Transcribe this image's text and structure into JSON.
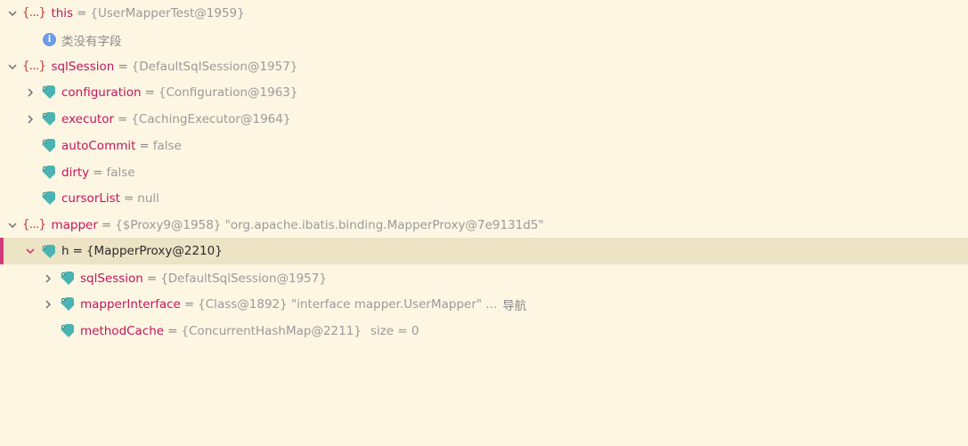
{
  "rows": [
    {
      "name": "this",
      "value": "{UserMapperTest@1959}"
    },
    {
      "message": "类没有字段"
    },
    {
      "name": "sqlSession",
      "value": "{DefaultSqlSession@1957}"
    },
    {
      "name": "configuration",
      "value": "{Configuration@1963}"
    },
    {
      "name": "executor",
      "value": "{CachingExecutor@1964}"
    },
    {
      "name": "autoCommit",
      "value": "false"
    },
    {
      "name": "dirty",
      "value": "false"
    },
    {
      "name": "cursorList",
      "value": "null"
    },
    {
      "name": "mapper",
      "value": "{$Proxy9@1958} \"org.apache.ibatis.binding.MapperProxy@7e9131d5\""
    },
    {
      "name": "h",
      "value": "{MapperProxy@2210}"
    },
    {
      "name": "sqlSession",
      "value": "{DefaultSqlSession@1957}"
    },
    {
      "name": "mapperInterface",
      "value": "{Class@1892} \"interface mapper.UserMapper\" ...",
      "link": "导航"
    },
    {
      "name": "methodCache",
      "value": "{ConcurrentHashMap@2211}",
      "extra": "size = 0"
    }
  ],
  "object_icon_text": "{...}",
  "equals": "=",
  "colors": {
    "background": "#fdf6e3",
    "selected_row": "#ede3c5",
    "selected_marker": "#d13b7a",
    "field_name": "#c4155b",
    "object_icon": "#c0392b",
    "field_tag": "#4cb3b3",
    "info_icon": "#6b9be6"
  }
}
